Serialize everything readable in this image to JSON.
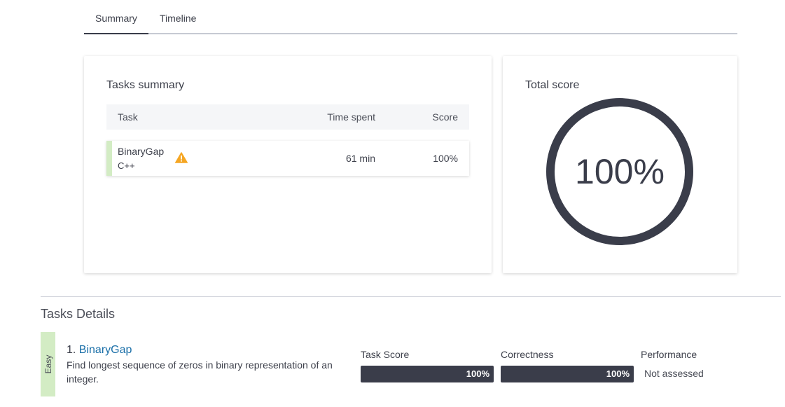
{
  "tabs": {
    "summary": "Summary",
    "timeline": "Timeline",
    "active": "Summary"
  },
  "tasks_summary": {
    "title": "Tasks summary",
    "headers": {
      "task": "Task",
      "time_spent": "Time spent",
      "score": "Score"
    },
    "rows": [
      {
        "name": "BinaryGap",
        "language": "C++",
        "warning_icon": "warning-icon",
        "time_spent": "61 min",
        "score": "100%"
      }
    ]
  },
  "total_score": {
    "title": "Total score",
    "value": "100%",
    "fraction": 1.0
  },
  "tasks_details": {
    "title": "Tasks Details",
    "items": [
      {
        "difficulty": "Easy",
        "number": "1.",
        "name": "BinaryGap",
        "description": "Find longest sequence of zeros in binary representation of an integer.",
        "task_score_label": "Task Score",
        "task_score": "100%",
        "task_score_fraction": 1.0,
        "correctness_label": "Correctness",
        "correctness": "100%",
        "correctness_fraction": 1.0,
        "performance_label": "Performance",
        "performance": "Not assessed"
      }
    ]
  },
  "colors": {
    "accent_dark": "#3a3d4a",
    "easy_green": "#d3ecc4",
    "link_blue": "#1a6fa8",
    "warning_orange": "#f5a623"
  }
}
